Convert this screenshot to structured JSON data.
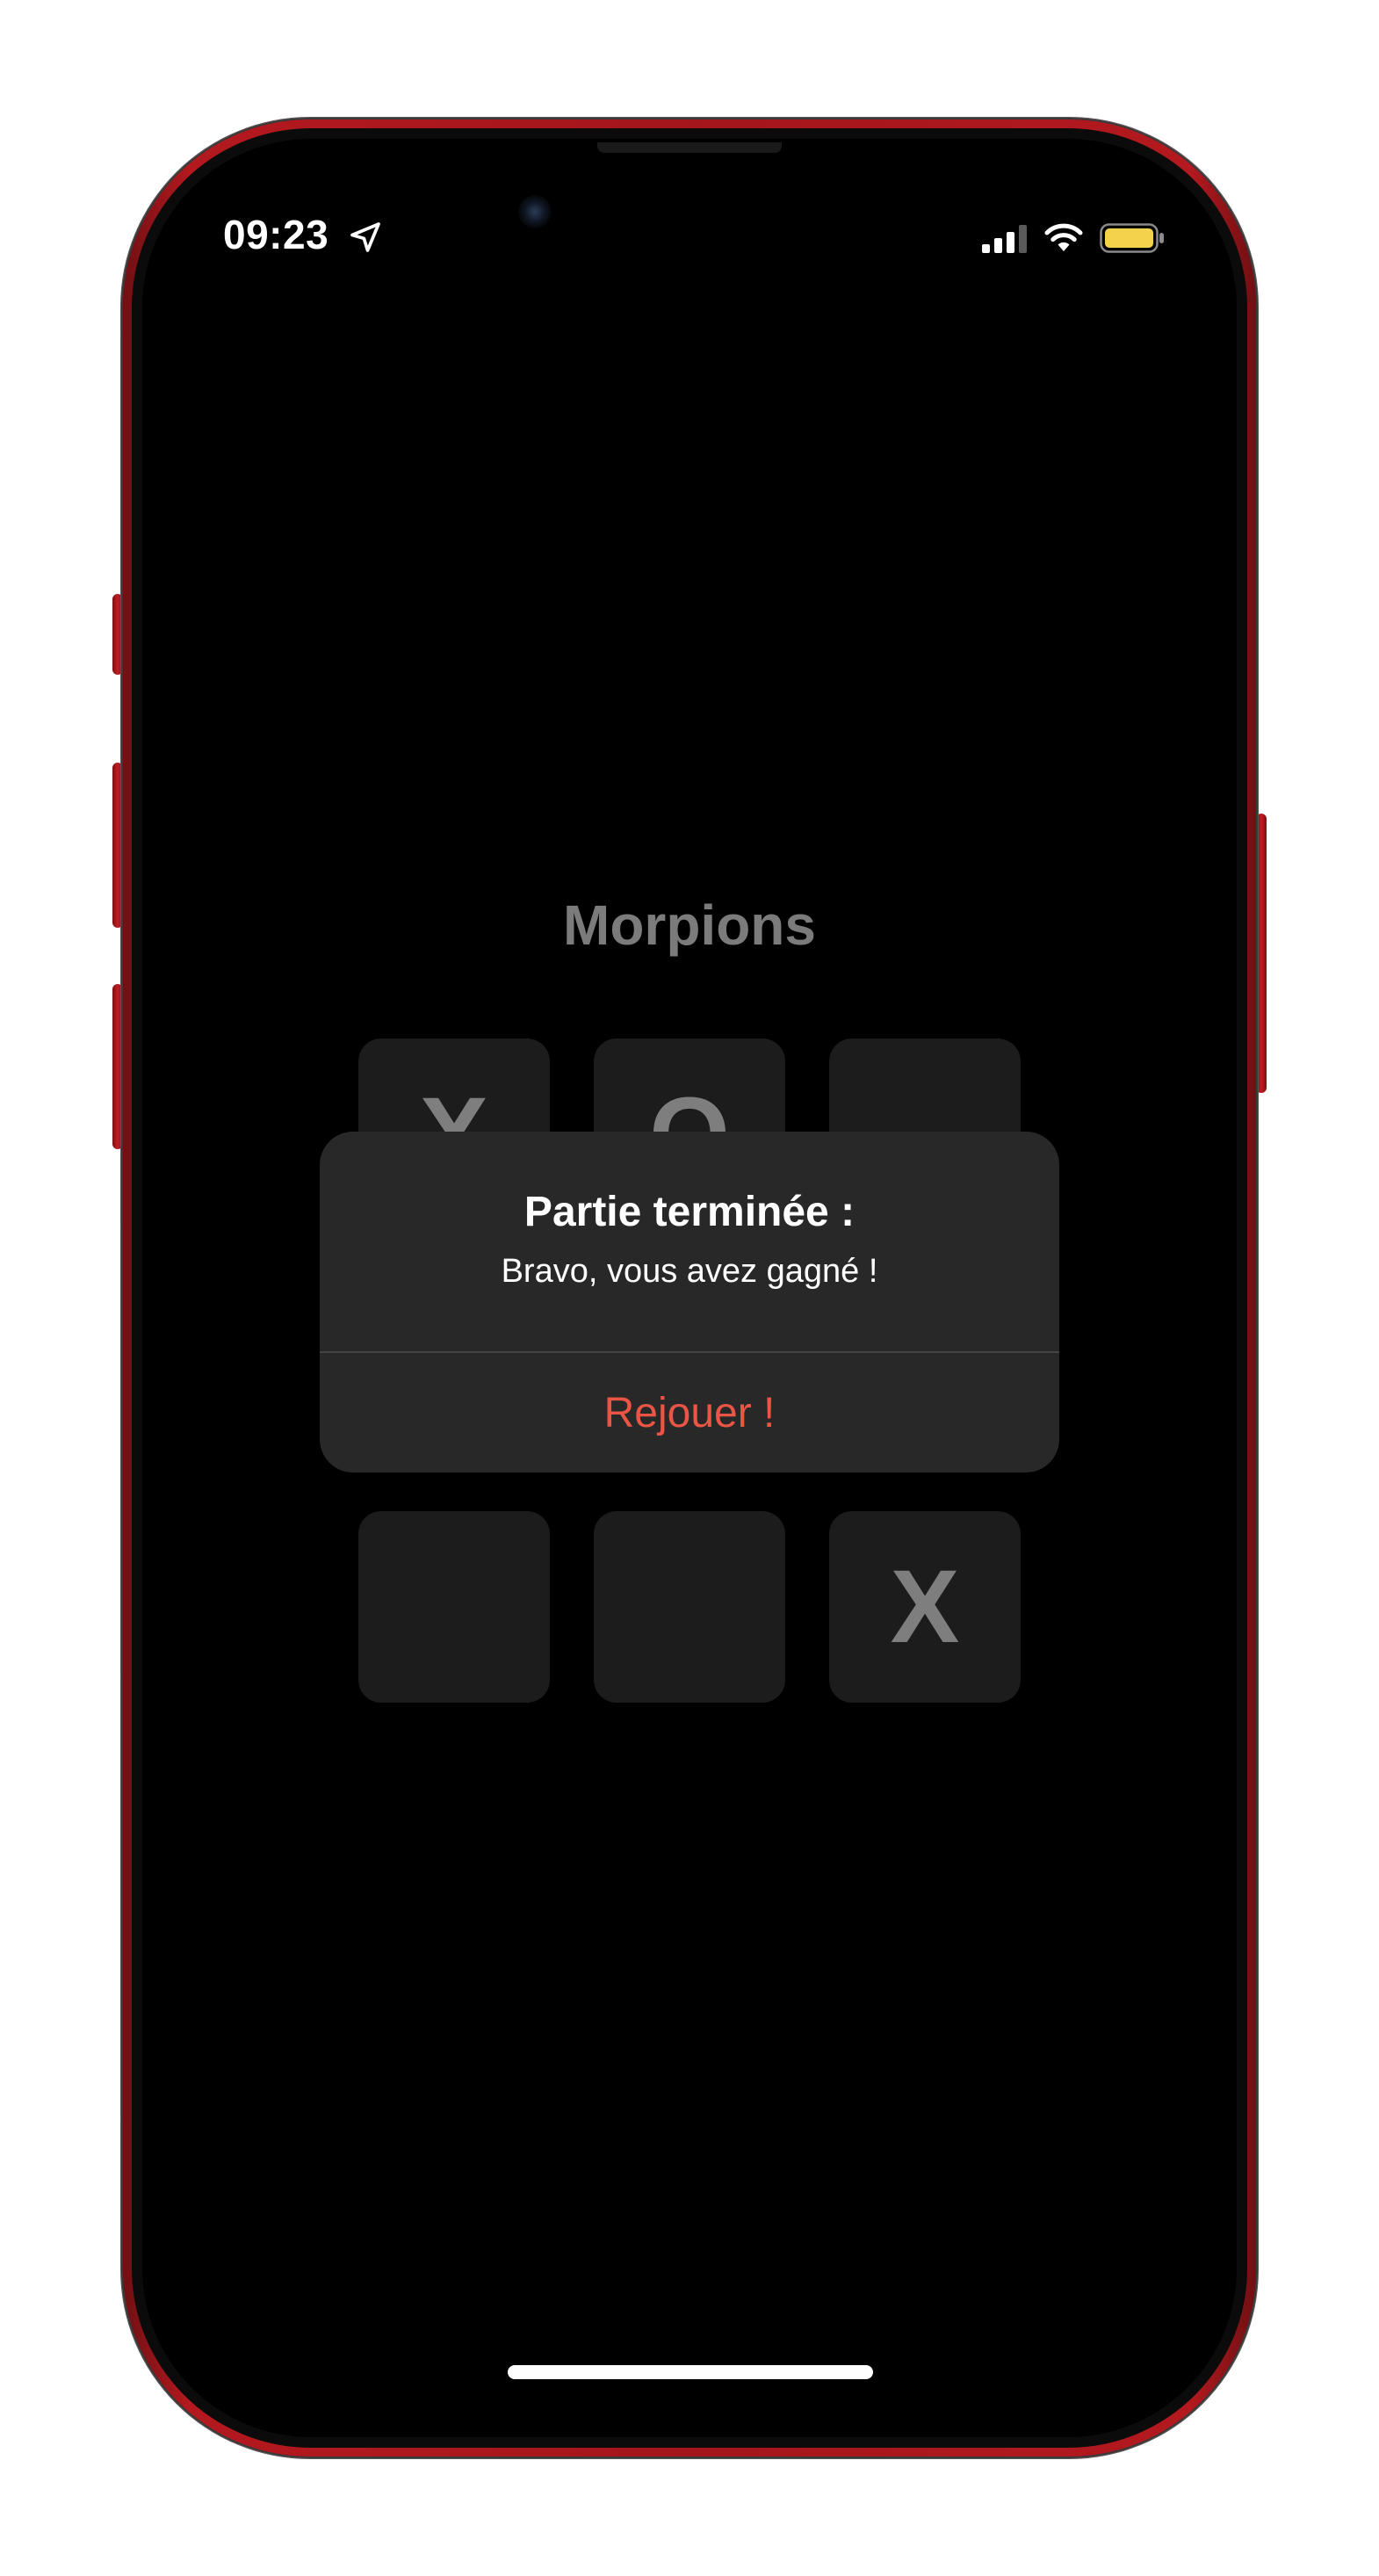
{
  "status_bar": {
    "time": "09:23",
    "location_icon": "location-arrow-icon",
    "signal_icon": "cellular-signal-icon",
    "wifi_icon": "wifi-icon",
    "battery_icon": "battery-icon",
    "battery_color": "#f5d24b"
  },
  "app": {
    "title": "Morpions"
  },
  "board": {
    "cells": [
      "X",
      "O",
      "",
      "",
      "",
      "",
      "",
      "",
      "X"
    ]
  },
  "alert": {
    "title": "Partie terminée :",
    "message": "Bravo, vous avez gagné !",
    "button_label": "Rejouer !",
    "button_color": "#eb5545"
  },
  "colors": {
    "frame": "#a3161b",
    "background": "#000000",
    "cell_background": "#1c1c1c",
    "alert_background": "#282828"
  }
}
